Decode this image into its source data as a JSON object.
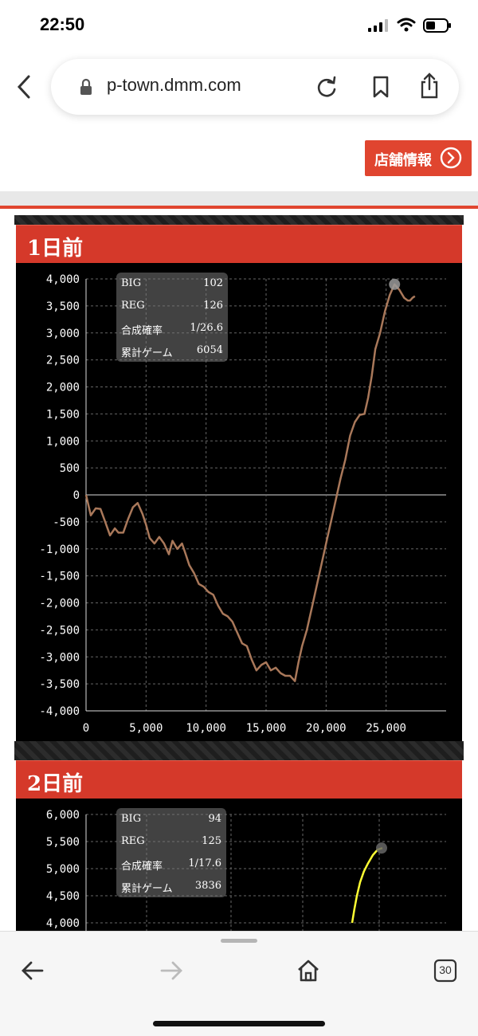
{
  "status_bar": {
    "time": "22:50"
  },
  "browser": {
    "url": "p-town.dmm.com"
  },
  "store_button": {
    "label": "店舗情報"
  },
  "bottom_bar": {
    "tab_count": "30"
  },
  "colors": {
    "accent_red": "#d5392a",
    "button_red": "#e0452f",
    "line_day1": "#a9785a",
    "line_day2": "#ffff33"
  },
  "panels": [
    {
      "title": "1日前",
      "stats": [
        {
          "label": "BIG",
          "value": "102"
        },
        {
          "label": "REG",
          "value": "126"
        },
        {
          "label": "合成確率",
          "value": "1/26.6"
        },
        {
          "label": "累計ゲーム",
          "value": "6054"
        }
      ]
    },
    {
      "title": "2日前",
      "stats": [
        {
          "label": "BIG",
          "value": "94"
        },
        {
          "label": "REG",
          "value": "125"
        },
        {
          "label": "合成確率",
          "value": "1/17.6"
        },
        {
          "label": "累計ゲーム",
          "value": "3836"
        }
      ]
    }
  ],
  "chart_data": [
    {
      "type": "line",
      "title": "1日前",
      "xlabel": "",
      "ylabel": "",
      "xlim": [
        0,
        30000
      ],
      "ylim": [
        -4000,
        4000
      ],
      "x_ticks": [
        "0",
        "5,000",
        "10,000",
        "15,000",
        "20,000",
        "25,000"
      ],
      "x_tick_values": [
        0,
        5000,
        10000,
        15000,
        20000,
        25000
      ],
      "y_ticks": [
        "4,000",
        "3,500",
        "3,000",
        "2,500",
        "2,000",
        "1,500",
        "1,000",
        "500",
        "0",
        "-500",
        "-1,000",
        "-1,500",
        "-2,000",
        "-2,500",
        "-3,000",
        "-3,500",
        "-4,000"
      ],
      "y_tick_values": [
        4000,
        3500,
        3000,
        2500,
        2000,
        1500,
        1000,
        500,
        0,
        -500,
        -1000,
        -1500,
        -2000,
        -2500,
        -3000,
        -3500,
        -4000
      ],
      "grid": true,
      "series": [
        {
          "x": [
            0,
            400,
            800,
            1200,
            1600,
            2000,
            2400,
            2700,
            3100,
            3500,
            3900,
            4300,
            4700,
            5000,
            5300,
            5700,
            6100,
            6500,
            6900,
            7200,
            7600,
            8000,
            8300,
            8600,
            9000,
            9400,
            9800,
            10200,
            10600,
            11000,
            11400,
            11800,
            12200,
            12600,
            13000,
            13400,
            13800,
            14200,
            14600,
            15000,
            15400,
            15800,
            16200,
            16600,
            17000,
            17400,
            17700,
            18000,
            18400,
            18800,
            19200,
            19600,
            20000,
            20400,
            20800,
            21200,
            21600,
            22000,
            22400,
            22800,
            23200,
            23500,
            23800,
            24100,
            24500,
            24900,
            25300,
            25700,
            26100,
            26500,
            26800,
            27000,
            27200,
            27400
          ],
          "y": [
            0,
            -380,
            -250,
            -260,
            -500,
            -750,
            -620,
            -700,
            -700,
            -450,
            -230,
            -150,
            -350,
            -550,
            -800,
            -900,
            -780,
            -900,
            -1100,
            -850,
            -1000,
            -900,
            -1100,
            -1300,
            -1450,
            -1650,
            -1700,
            -1800,
            -1850,
            -2050,
            -2200,
            -2250,
            -2350,
            -2550,
            -2750,
            -2800,
            -3050,
            -3250,
            -3150,
            -3100,
            -3250,
            -3200,
            -3300,
            -3350,
            -3350,
            -3450,
            -3100,
            -2800,
            -2500,
            -2100,
            -1700,
            -1300,
            -900,
            -500,
            -100,
            300,
            650,
            1100,
            1350,
            1480,
            1500,
            1800,
            2200,
            2700,
            3000,
            3400,
            3700,
            3900,
            3800,
            3650,
            3600,
            3600,
            3650,
            3680
          ],
          "end_marker": true
        }
      ]
    },
    {
      "type": "line",
      "title": "2日前",
      "xlabel": "",
      "ylabel": "",
      "ylim": [
        4000,
        6000
      ],
      "y_ticks": [
        "6,000",
        "5,500",
        "5,000",
        "4,500",
        "4,000"
      ],
      "y_tick_values": [
        6000,
        5500,
        5000,
        4500,
        4000
      ],
      "grid": true,
      "series": [
        {
          "x": [
            0.05,
            0.12,
            0.2,
            0.3,
            0.42,
            0.55,
            0.7,
            0.85,
            1.0
          ],
          "y": [
            4000,
            4250,
            4500,
            4750,
            4950,
            5100,
            5250,
            5350,
            5380
          ],
          "end_marker": true
        }
      ]
    }
  ]
}
